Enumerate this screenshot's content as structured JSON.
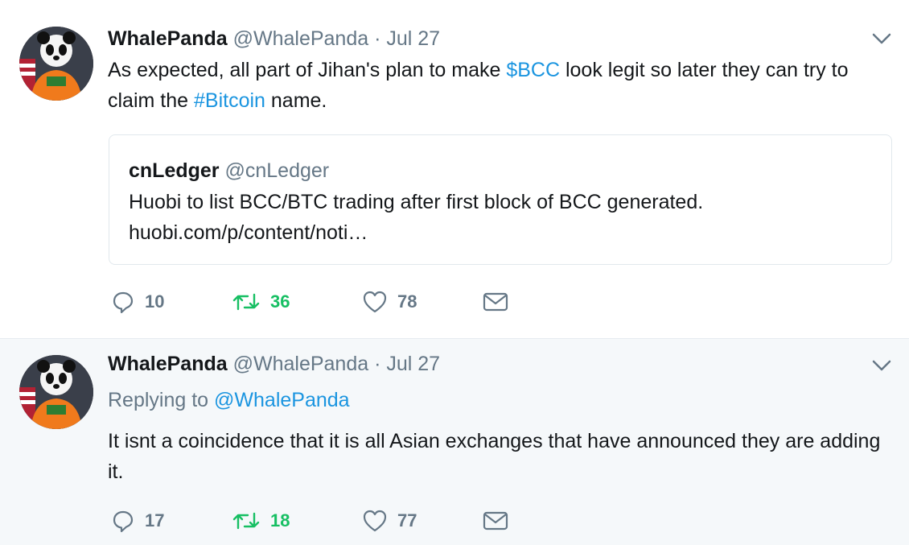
{
  "tweets": [
    {
      "name": "WhalePanda",
      "handle": "@WhalePanda",
      "separator": "·",
      "date": "Jul 27",
      "text_parts": [
        "As expected, all part of Jihan's plan to make ",
        "$BCC",
        " look legit so later they can try to claim the ",
        "#Bitcoin",
        " name."
      ],
      "quote": {
        "name": "cnLedger",
        "handle": "@cnLedger",
        "line1": "Huobi to list BCC/BTC trading after first block of BCC generated.",
        "line2": "huobi.com/p/content/noti…"
      },
      "replies": "10",
      "retweets": "36",
      "likes": "78"
    },
    {
      "name": "WhalePanda",
      "handle": "@WhalePanda",
      "separator": "·",
      "date": "Jul 27",
      "replying_prefix": "Replying to ",
      "replying_handle": "@WhalePanda",
      "text": "It isnt a coincidence that it is all Asian exchanges that have announced they are adding it.",
      "replies": "17",
      "retweets": "18",
      "likes": "77"
    }
  ],
  "colors": {
    "link": "#1b95e0",
    "retweet": "#17bf63",
    "muted": "#657786",
    "reply_background": "#f5f8fa"
  },
  "icons": [
    "avatar-panda",
    "chevron-down-icon",
    "reply-icon",
    "retweet-icon",
    "like-icon",
    "direct-message-icon"
  ]
}
